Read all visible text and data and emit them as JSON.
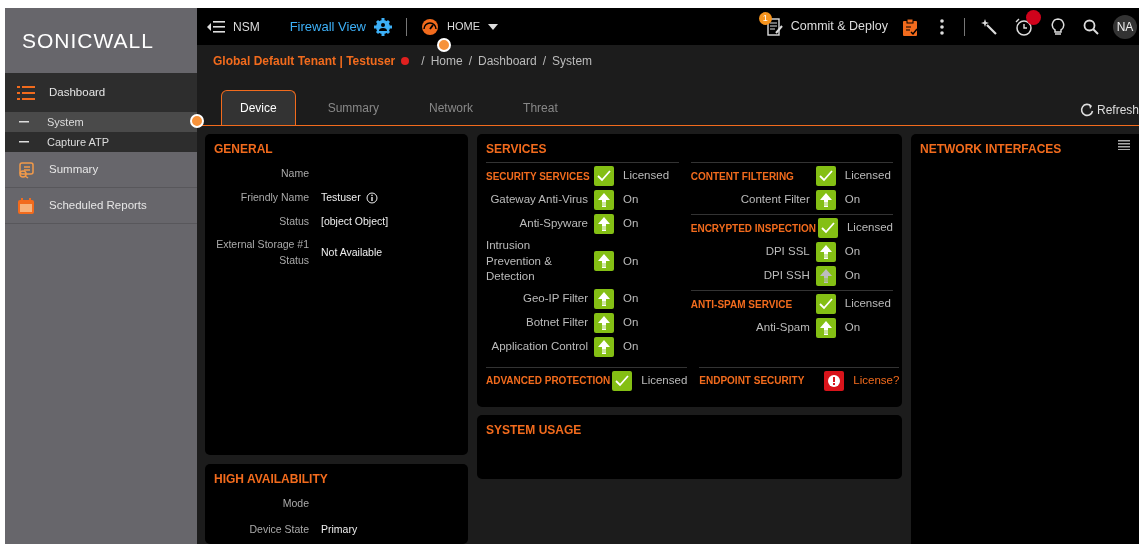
{
  "brand": {
    "logo_text": "SONICWALL"
  },
  "topbar": {
    "nav_label": "NSM",
    "view_link": "Firewall View",
    "home_label": "HOME",
    "commit_badge": "1",
    "commit_label": "Commit & Deploy",
    "alarm_alert": true,
    "avatar": "NA"
  },
  "breadcrumb": {
    "tenant": "Global Default Tenant | Testuser",
    "tenant_alert": true,
    "path": [
      {
        "separator": "/",
        "label": "Home"
      },
      {
        "separator": "/",
        "label": "Dashboard"
      },
      {
        "separator": "/",
        "label": "System"
      }
    ]
  },
  "sidebar": {
    "items": [
      {
        "label": "Dashboard",
        "kind": "list",
        "selected": false,
        "expanded": true,
        "children": [
          {
            "label": "System",
            "selected": true
          },
          {
            "label": "Capture ATP",
            "selected": false
          }
        ]
      },
      {
        "label": "Summary",
        "kind": "summary",
        "selected": false
      },
      {
        "label": "Scheduled Reports",
        "kind": "calendar",
        "selected": false
      }
    ]
  },
  "tabs": [
    {
      "label": "Device",
      "selected": true
    },
    {
      "label": "Summary",
      "selected": false
    },
    {
      "label": "Network",
      "selected": false
    },
    {
      "label": "Threat",
      "selected": false
    }
  ],
  "refresh_label": "Refresh",
  "general": {
    "title": "GENERAL",
    "fields": [
      {
        "label": "Name"
      },
      {
        "label": "Friendly Name",
        "value": "Testuser",
        "info": true
      },
      {
        "label": "Status",
        "value": "[object Object]"
      },
      {
        "label": "External Storage #1 Status",
        "value": "Not Available"
      }
    ]
  },
  "services": {
    "title": "SERVICES",
    "left": [
      {
        "title": "SECURITY SERVICES",
        "kind": "check",
        "status": "Licensed",
        "items": [
          {
            "label": "Gateway Anti-Virus",
            "kind": "arrow",
            "active": true,
            "status": "On"
          },
          {
            "label": "Anti-Spyware",
            "kind": "arrow",
            "active": true,
            "status": "On"
          },
          {
            "label": "Intrusion Prevention & Detection",
            "kind": "arrow",
            "active": true,
            "status": "On"
          },
          {
            "label": "Geo-IP Filter",
            "kind": "arrow",
            "active": true,
            "status": "On"
          },
          {
            "label": "Botnet Filter",
            "kind": "arrow",
            "active": true,
            "status": "On"
          },
          {
            "label": "Application Control",
            "kind": "arrow",
            "active": true,
            "status": "On"
          }
        ]
      }
    ],
    "right": [
      {
        "title": "CONTENT FILTERING",
        "kind": "check",
        "status": "Licensed",
        "items": [
          {
            "label": "Content Filter",
            "kind": "arrow",
            "active": true,
            "status": "On"
          }
        ]
      },
      {
        "title": "ENCRYPTED INSPECTION",
        "kind": "check",
        "status": "Licensed",
        "items": [
          {
            "label": "DPI SSL",
            "kind": "arrow",
            "active": true,
            "status": "On"
          },
          {
            "label": "DPI SSH",
            "kind": "arrow",
            "active": false,
            "status": "On"
          }
        ]
      },
      {
        "title": "ANTI-SPAM SERVICE",
        "kind": "check",
        "status": "Licensed",
        "items": [
          {
            "label": "Anti-Spam",
            "kind": "arrow",
            "active": true,
            "status": "On"
          }
        ]
      }
    ],
    "bottom": [
      {
        "title": "ADVANCED PROTECTION",
        "kind": "check",
        "status": "Licensed"
      },
      {
        "title": "ENDPOINT SECURITY",
        "kind": "alert",
        "status": "License?"
      }
    ]
  },
  "system_usage": {
    "title": "SYSTEM USAGE"
  },
  "network_interfaces": {
    "title": "NETWORK INTERFACES"
  },
  "high_availability": {
    "title": "HIGH AVAILABILITY",
    "fields": [
      {
        "label": "Mode"
      },
      {
        "label": "Device State",
        "value": "Primary"
      }
    ]
  }
}
